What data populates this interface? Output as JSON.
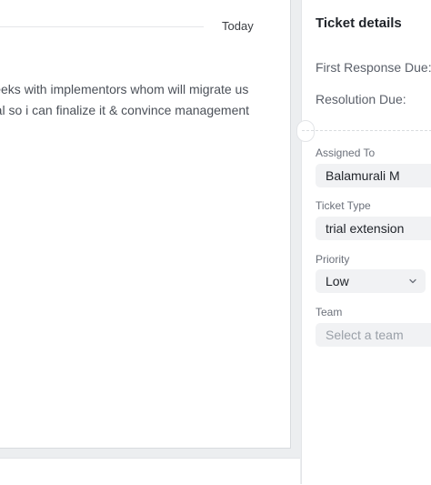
{
  "conversation": {
    "date_divider": "Today",
    "message_lines": [
      "Hi! We're reaching out for an extension of a few weeks with implementors whom will migrate us",
      "over from our old system. We need a few more weeks in trial so i can finalize it & convince management"
    ]
  },
  "details": {
    "title": "Ticket details",
    "first_response_label": "First Response Due:",
    "resolution_label": "Resolution Due:",
    "assigned_to": {
      "label": "Assigned To",
      "value": "Balamurali M"
    },
    "ticket_type": {
      "label": "Ticket Type",
      "value": "trial extension"
    },
    "priority": {
      "label": "Priority",
      "value": "Low"
    },
    "team": {
      "label": "Team",
      "placeholder": "Select a team"
    }
  },
  "icons": {
    "priority_dropdown": "chevron-down-icon"
  }
}
